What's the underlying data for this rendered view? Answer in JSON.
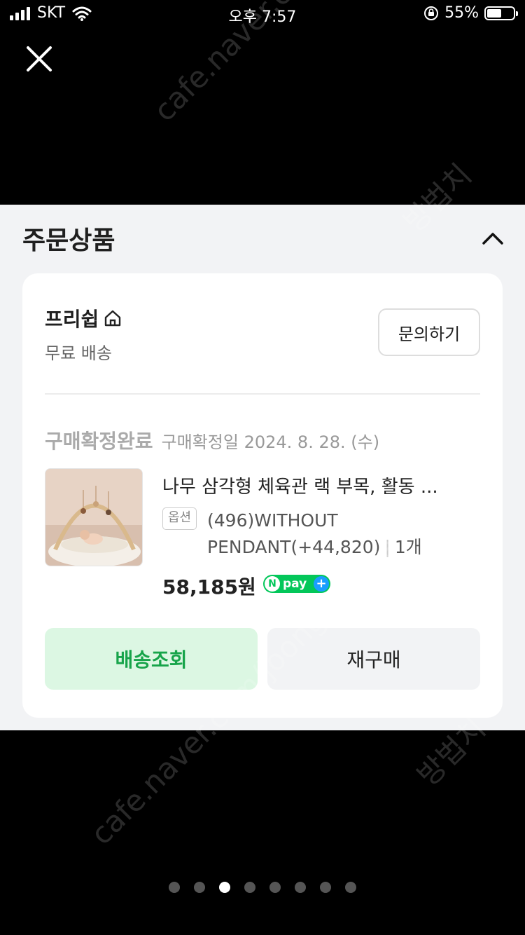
{
  "status_bar": {
    "carrier": "SKT",
    "time": "오후 7:57",
    "battery": "55%"
  },
  "sheet": {
    "title": "주문상품"
  },
  "order": {
    "shop_name": "프리쉽",
    "shipping": "무료 배송",
    "inquiry_button": "문의하기",
    "status": "구매확정완료",
    "confirm_date": "구매확정일 2024. 8. 28. (수)",
    "product_title": "나무 삼각형 체육관 랙 부목, 활동 ...",
    "option_badge": "옵션",
    "option_text": "(496)WITHOUT PENDANT(+44,820)",
    "quantity": "1개",
    "price": "58,185원",
    "npay_text": "pay",
    "track_button": "배송조회",
    "rebuy_button": "재구매"
  },
  "pager": {
    "count": 8,
    "active_index": 2
  },
  "watermarks": [
    "cafe.naver.com/joonggonara",
    "cafe.naver.com/joonggonara",
    "방법치",
    "방법치"
  ],
  "colors": {
    "green": "#17a44a",
    "green_bg": "#dcf7e3",
    "npay": "#03c75a"
  }
}
